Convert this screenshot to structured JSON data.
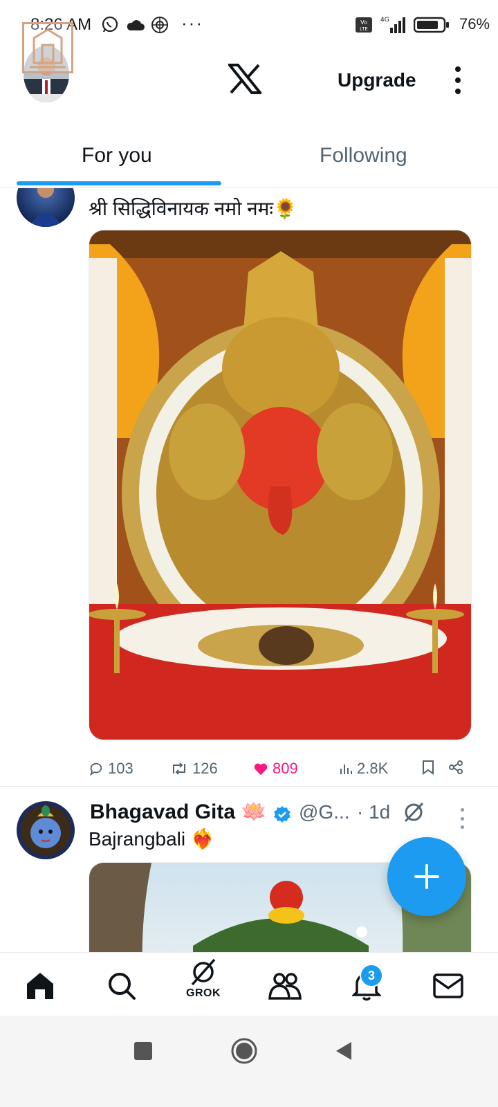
{
  "status_bar": {
    "time": "8:26 AM",
    "overflow": "···",
    "network": "4G",
    "battery": "76%"
  },
  "header": {
    "logo": "X",
    "upgrade_label": "Upgrade"
  },
  "tabs": [
    {
      "label": "For you",
      "selected": true
    },
    {
      "label": "Following",
      "selected": false
    }
  ],
  "posts": [
    {
      "text": "श्री सिद्धिविनायक नमो नमः🌻",
      "media_description": "Siddhivinayak Ganesha idol",
      "stats": {
        "replies": "103",
        "reposts": "126",
        "likes": "809",
        "views": "2.8K"
      }
    },
    {
      "author": "Bhagavad Gita 🪷",
      "handle": "@G...",
      "time": "· 1d",
      "text": "Bajrangbali ❤️‍🔥"
    }
  ],
  "bottom_nav": {
    "grok_label": "GROK",
    "notifications_count": "3"
  },
  "colors": {
    "accent": "#1d9bf0",
    "like": "#f91880",
    "text": "#0f1419",
    "muted": "#536471"
  }
}
